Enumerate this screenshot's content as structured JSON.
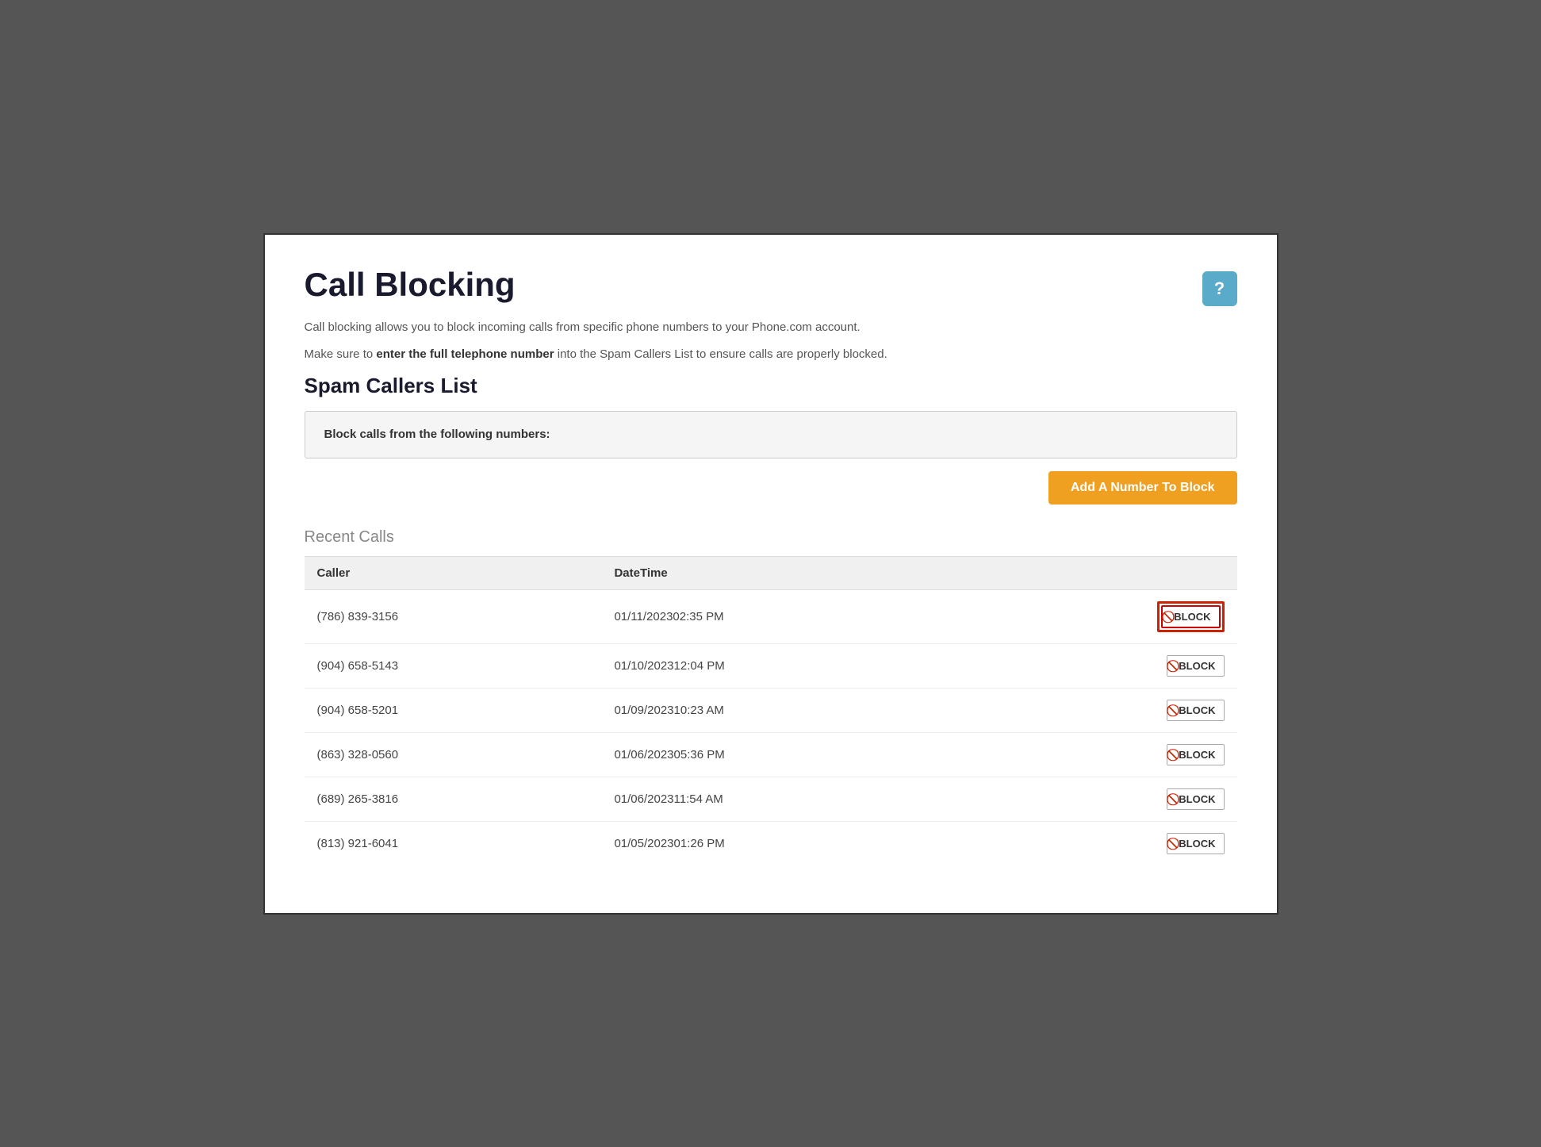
{
  "page": {
    "title": "Call Blocking",
    "help_button_label": "?",
    "description1": "Call blocking allows you to block incoming calls from specific phone numbers to your Phone.com account.",
    "description2_prefix": "Make sure to ",
    "description2_bold": "enter the full telephone number",
    "description2_suffix": " into the Spam Callers List to ensure calls are properly blocked.",
    "spam_section_title": "Spam Callers List",
    "spam_label": "Block calls from the following numbers:",
    "add_button_label": "Add A Number To Block",
    "recent_calls_title": "Recent Calls",
    "table_headers": {
      "caller": "Caller",
      "datetime": "DateTime",
      "action": ""
    },
    "recent_calls": [
      {
        "caller": "(786) 839-3156",
        "datetime": "01/11/202302:35 PM",
        "highlighted": true
      },
      {
        "caller": "(904) 658-5143",
        "datetime": "01/10/202312:04 PM",
        "highlighted": false
      },
      {
        "caller": "(904) 658-5201",
        "datetime": "01/09/202310:23 AM",
        "highlighted": false
      },
      {
        "caller": "(863) 328-0560",
        "datetime": "01/06/202305:36 PM",
        "highlighted": false
      },
      {
        "caller": "(689) 265-3816",
        "datetime": "01/06/202311:54 AM",
        "highlighted": false
      },
      {
        "caller": "(813) 921-6041",
        "datetime": "01/05/202301:26 PM",
        "highlighted": false
      }
    ],
    "block_button_label": "BLOCK"
  },
  "colors": {
    "accent_blue": "#5aabca",
    "accent_orange": "#f0a020",
    "block_red": "#cc2200",
    "highlight_border": "#cc0000"
  }
}
